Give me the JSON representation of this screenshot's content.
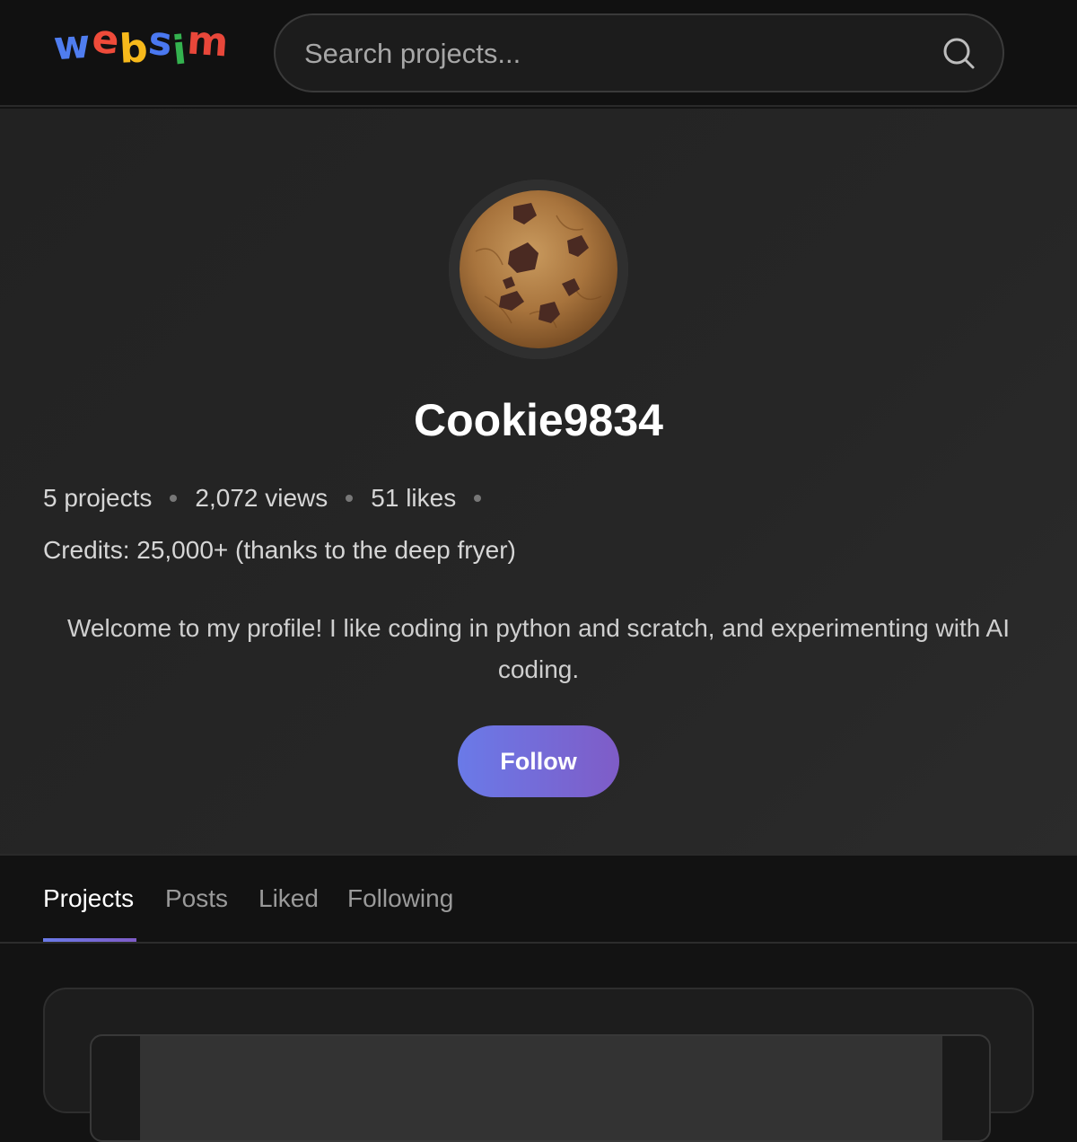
{
  "header": {
    "logo_text": "websim",
    "logo_letters": [
      "w",
      "e",
      "b",
      "s",
      "i",
      "m"
    ],
    "search_placeholder": "Search projects...",
    "search_icon": "search-icon"
  },
  "profile": {
    "avatar": "cookie-avatar",
    "username": "Cookie9834",
    "stats": {
      "projects": "5 projects",
      "views": "2,072 views",
      "likes": "51 likes"
    },
    "credits": "Credits: 25,000+ (thanks to the deep fryer)",
    "bio": "Welcome to my profile! I like coding in python and scratch, and experimenting with AI coding.",
    "follow_label": "Follow"
  },
  "tabs": [
    {
      "label": "Projects",
      "active": true
    },
    {
      "label": "Posts",
      "active": false
    },
    {
      "label": "Liked",
      "active": false
    },
    {
      "label": "Following",
      "active": false
    }
  ],
  "colors": {
    "accent_start": "#6a7ae8",
    "accent_end": "#7f5cc7",
    "background": "#131313"
  }
}
